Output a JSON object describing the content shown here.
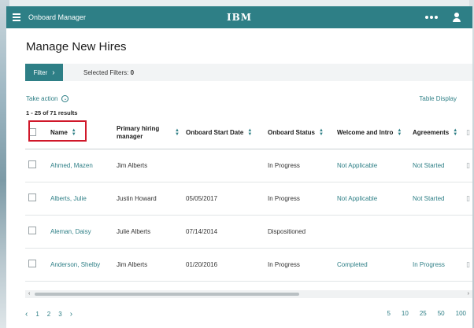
{
  "header": {
    "app_title": "Onboard Manager",
    "brand": "IBM",
    "menu_icon": "hamburger-menu-icon",
    "more_icon": "more-options-icon",
    "user_icon": "user-icon"
  },
  "page": {
    "title": "Manage New Hires"
  },
  "filter": {
    "button_label": "Filter",
    "selected_label": "Selected Filters:",
    "selected_count": "0"
  },
  "actions": {
    "take_action": "Take action",
    "table_display": "Table Display",
    "results_text": "1 - 25 of 71 results"
  },
  "table": {
    "columns": [
      "Name",
      "Primary hiring manager",
      "Onboard Start Date",
      "Onboard Status",
      "Welcome and Intro",
      "Agreements"
    ],
    "rows": [
      {
        "name": "Ahmed, Mazen",
        "manager": "Jim Alberts",
        "start_date": "",
        "status": "In Progress",
        "welcome": "Not Applicable",
        "agreements": "Not Started"
      },
      {
        "name": "Alberts, Julie",
        "manager": "Justin Howard",
        "start_date": "05/05/2017",
        "status": "In Progress",
        "welcome": "Not Applicable",
        "agreements": "Not Started"
      },
      {
        "name": "Aleman, Daisy",
        "manager": "Julie Alberts",
        "start_date": "07/14/2014",
        "status": "Dispositioned",
        "welcome": "",
        "agreements": ""
      },
      {
        "name": "Anderson, Shelby",
        "manager": "Jim Alberts",
        "start_date": "01/20/2016",
        "status": "In Progress",
        "welcome": "Completed",
        "agreements": "In Progress"
      }
    ]
  },
  "pagination": {
    "pages": [
      "1",
      "2",
      "3"
    ],
    "page_sizes": [
      "5",
      "10",
      "25",
      "50",
      "100"
    ]
  },
  "colors": {
    "accent": "#2e7f86",
    "highlight": "#d0182a"
  }
}
